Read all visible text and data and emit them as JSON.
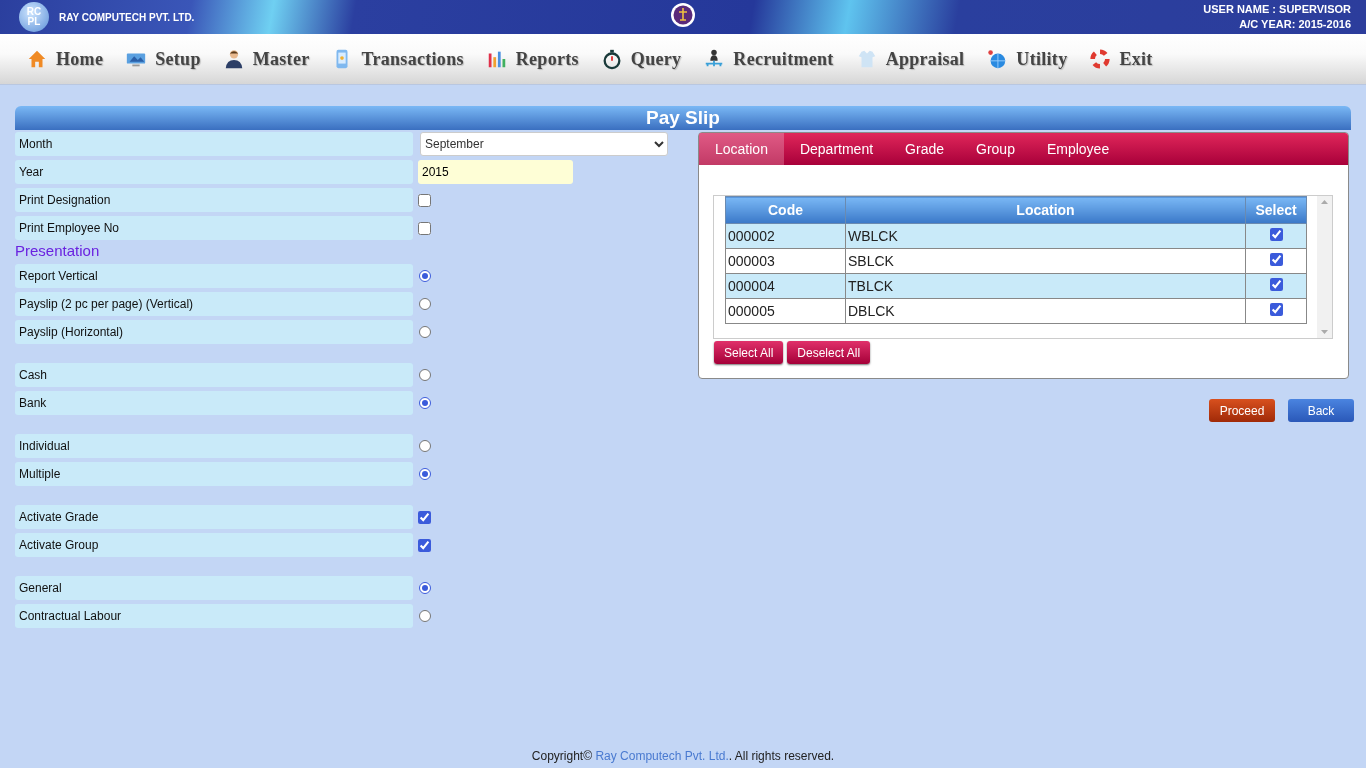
{
  "header": {
    "logo_text": "RCPL",
    "company": "RAY COMPUTECH PVT. LTD.",
    "user": "USER NAME : SUPERVISOR",
    "year": "A/C YEAR: 2015-2016"
  },
  "nav": [
    {
      "label": "Home"
    },
    {
      "label": "Setup"
    },
    {
      "label": "Master"
    },
    {
      "label": "Transactions"
    },
    {
      "label": "Reports"
    },
    {
      "label": "Query"
    },
    {
      "label": "Recruitment"
    },
    {
      "label": "Appraisal"
    },
    {
      "label": "Utility"
    },
    {
      "label": "Exit"
    }
  ],
  "title": "Pay Slip",
  "form": {
    "groups": [
      {
        "rows": [
          {
            "kind": "select",
            "label": "Month",
            "value": "September"
          },
          {
            "kind": "text",
            "label": "Year",
            "value": "2015"
          },
          {
            "kind": "checkbox",
            "label": "Print Designation",
            "checked": false
          },
          {
            "kind": "checkbox",
            "label": "Print Employee No",
            "checked": false
          }
        ]
      },
      {
        "heading": "Presentation",
        "rows": [
          {
            "kind": "radio",
            "label": "Report Vertical",
            "selected": true
          },
          {
            "kind": "radio",
            "label": "Payslip (2 pc per page) (Vertical)",
            "selected": false
          },
          {
            "kind": "radio",
            "label": "Payslip (Horizontal)",
            "selected": false
          }
        ]
      },
      {
        "rows": [
          {
            "kind": "radio",
            "label": "Cash",
            "selected": false
          },
          {
            "kind": "radio",
            "label": "Bank",
            "selected": true
          }
        ]
      },
      {
        "rows": [
          {
            "kind": "radio",
            "label": "Individual",
            "selected": false
          },
          {
            "kind": "radio",
            "label": "Multiple",
            "selected": true
          }
        ]
      },
      {
        "rows": [
          {
            "kind": "checkbox",
            "label": "Activate Grade",
            "checked": true
          },
          {
            "kind": "checkbox",
            "label": "Activate Group",
            "checked": true
          }
        ]
      },
      {
        "rows": [
          {
            "kind": "radio",
            "label": "General",
            "selected": true
          },
          {
            "kind": "radio",
            "label": "Contractual Labour",
            "selected": false
          }
        ]
      }
    ]
  },
  "panel": {
    "tabs": [
      {
        "label": "Location",
        "selected": true
      },
      {
        "label": "Department",
        "selected": false
      },
      {
        "label": "Grade",
        "selected": false
      },
      {
        "label": "Group",
        "selected": false
      },
      {
        "label": "Employee",
        "selected": false
      }
    ],
    "table": {
      "columns": [
        "Code",
        "Location",
        "Select"
      ],
      "rows": [
        {
          "code": "000002",
          "location": "WBLCK",
          "checked": true
        },
        {
          "code": "000003",
          "location": "SBLCK",
          "checked": true
        },
        {
          "code": "000004",
          "location": "TBLCK",
          "checked": true
        },
        {
          "code": "000005",
          "location": "DBLCK",
          "checked": true
        }
      ]
    },
    "buttons": [
      "Select All",
      "Deselect All"
    ]
  },
  "actions": [
    {
      "label": "Proceed",
      "kind": "primary"
    },
    {
      "label": "Back",
      "kind": "secondary"
    }
  ],
  "footer": {
    "before": "Copyright© ",
    "link": "Ray Computech Pvt. Ltd.",
    "after": ". All rights reserved."
  }
}
